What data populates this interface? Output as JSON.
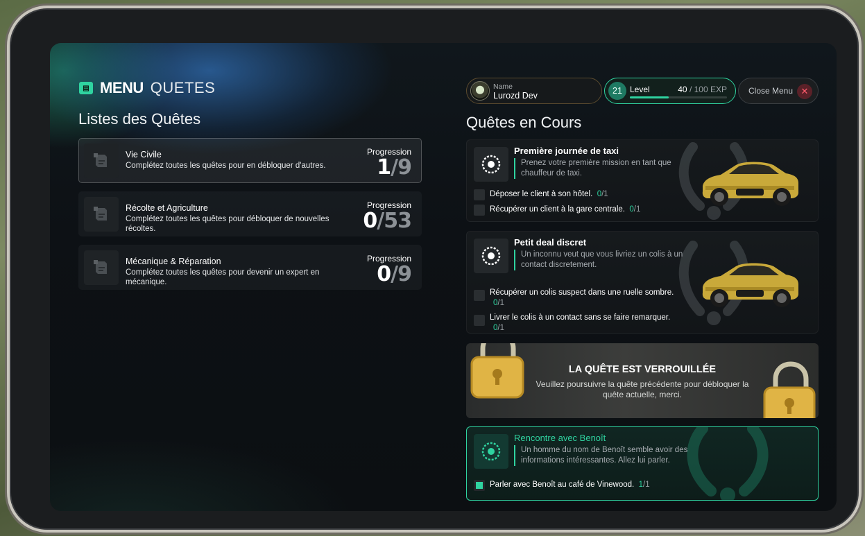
{
  "menu": {
    "title_bold": "MENU",
    "title_light": "QUETES",
    "book_icon": "book-icon"
  },
  "left": {
    "heading": "Listes des Quêtes",
    "quests": [
      {
        "title": "Vie Civile",
        "description": "Complétez toutes les quêtes pour en débloquer d'autres.",
        "progress_label": "Progression",
        "done": "1",
        "total": "/9",
        "active": true
      },
      {
        "title": "Récolte et Agriculture",
        "description": "Complétez toutes les quêtes pour débloquer de nouvelles récoltes.",
        "progress_label": "Progression",
        "done": "0",
        "total": "/53",
        "active": false
      },
      {
        "title": "Mécanique & Réparation",
        "description": "Complétez toutes les quêtes pour devenir un expert en mécanique.",
        "progress_label": "Progression",
        "done": "0",
        "total": "/9",
        "active": false
      }
    ]
  },
  "player": {
    "name_label": "Name",
    "name": "Lurozd Dev"
  },
  "level": {
    "value": "21",
    "label": "Level",
    "exp_current": "40",
    "exp_sep": "/",
    "exp_total": "100 EXP",
    "progress": 0.4
  },
  "close": {
    "label": "Close Menu",
    "icon": "close-icon"
  },
  "right": {
    "heading": "Quêtes en Cours",
    "cards": [
      {
        "title": "Première journée de taxi",
        "description": "Prenez votre première mission en tant que chauffeur de taxi.",
        "objectives": [
          {
            "text": "Déposer le client à son hôtel.",
            "count": "0",
            "total": "/1"
          },
          {
            "text": "Récupérer un client à la gare centrale.",
            "count": "0",
            "total": "/1"
          }
        ]
      },
      {
        "title": "Petit deal discret",
        "description": "Un inconnu veut que vous livriez un colis à un contact discretement.",
        "objectives": [
          {
            "text": "Récupérer un colis suspect dans une ruelle sombre.",
            "count": "0",
            "total": "/1"
          },
          {
            "text": "Livrer le colis à un contact sans se faire remarquer.",
            "count": "0",
            "total": "/1"
          }
        ]
      }
    ],
    "locked": {
      "title": "LA QUÊTE EST VERROUILLÉE",
      "message": "Veuillez poursuivre la quête précédente pour débloquer la quête actuelle, merci."
    },
    "completed": {
      "title": "Rencontre avec Benoît",
      "description": "Un homme du nom de Benoît semble avoir des informations intéressantes. Allez lui parler.",
      "objective": {
        "text": "Parler avec Benoît au café de Vinewood.",
        "count": "1",
        "total": "/1"
      }
    }
  },
  "colors": {
    "accent": "#2fd3a0",
    "close": "#ff5c6c",
    "panel": "#0d1115"
  }
}
